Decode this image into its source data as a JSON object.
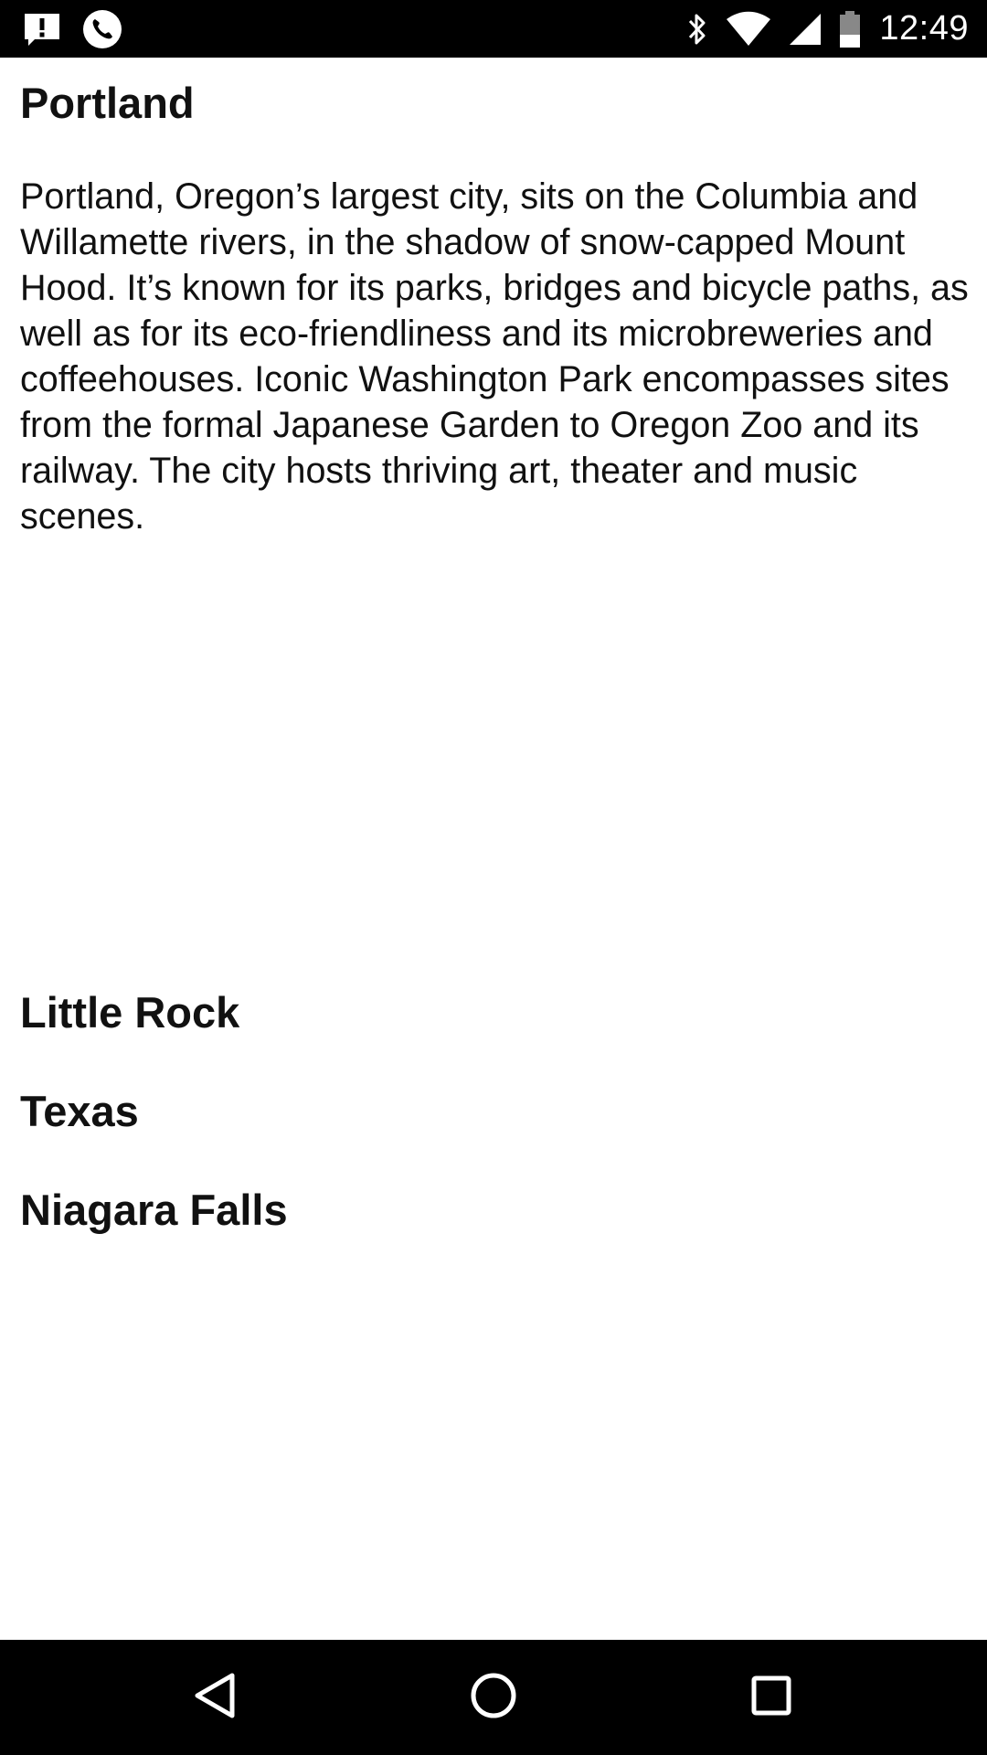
{
  "status_bar": {
    "time": "12:49",
    "left_icons": [
      "alert-message-icon",
      "phone-call-icon"
    ],
    "right_icons": [
      "bluetooth-icon",
      "wifi-icon",
      "cell-signal-icon",
      "battery-icon"
    ]
  },
  "cities": [
    {
      "name": "Portland",
      "description": "Portland, Oregon’s largest city, sits on the Columbia and Willamette rivers, in the shadow of snow-capped Mount Hood. It’s known for its parks, bridges and bicycle paths, as well as for its eco-friendliness and its microbreweries and coffeehouses. Iconic Washington Park encompasses sites from the formal Japanese Garden to Oregon Zoo and its railway. The city hosts thriving art, theater and music scenes."
    },
    {
      "name": "Little Rock"
    },
    {
      "name": "Texas"
    },
    {
      "name": "Niagara Falls"
    }
  ],
  "nav_bar": {
    "buttons": [
      "back-icon",
      "home-icon",
      "recents-icon"
    ]
  },
  "colors": {
    "status_bar_bg": "#000000",
    "nav_bar_bg": "#000000",
    "content_bg": "#ffffff",
    "text": "#111111"
  }
}
